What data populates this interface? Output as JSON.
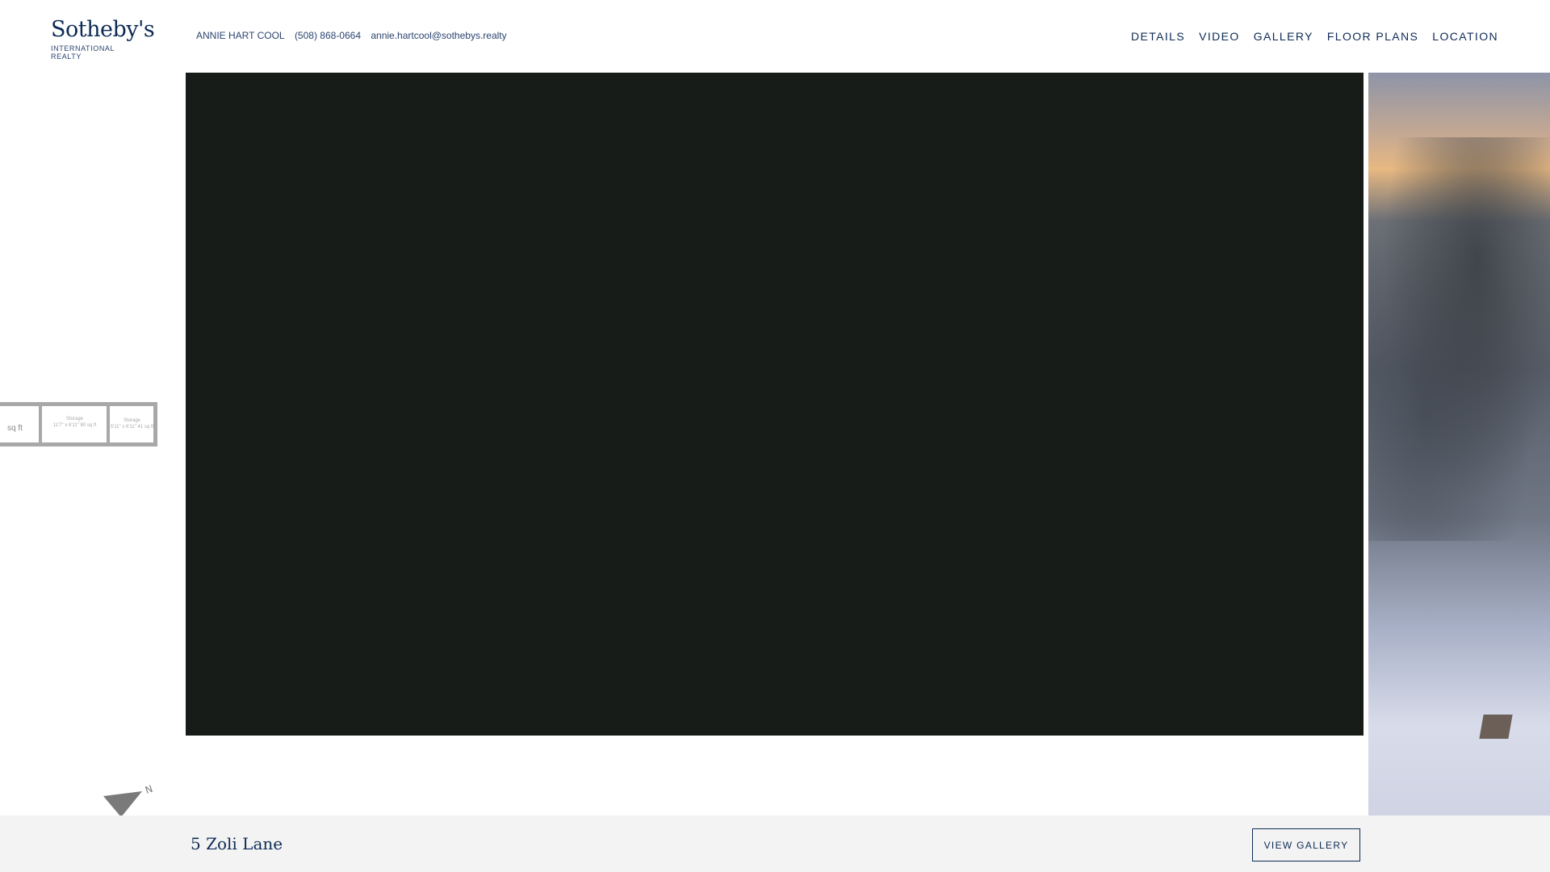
{
  "header": {
    "logo": {
      "name": "Sotheby's",
      "sub": "INTERNATIONAL REALTY"
    },
    "agent": {
      "name": "ANNIE HART COOL",
      "phone": "(508) 868-0664",
      "email": "annie.hartcool@sothebys.realty"
    },
    "nav": [
      "DETAILS",
      "VIDEO",
      "GALLERY",
      "FLOOR PLANS",
      "LOCATION"
    ]
  },
  "floorplan": {
    "rooms": [
      {
        "name": "",
        "size": "sq ft"
      },
      {
        "name": "Storage",
        "size": "11'7\" x 6'11\" 80 sq ft"
      },
      {
        "name": "Storage",
        "size": "5'11\" x 6'11\" 41 sq ft"
      }
    ],
    "compass_label": "N"
  },
  "footer": {
    "address": "5 Zoli Lane",
    "view_gallery": "VIEW GALLERY"
  },
  "colors": {
    "brand": "#0d2b55",
    "video_bg": "#181c19",
    "footer_bg": "#f3f3f3"
  }
}
